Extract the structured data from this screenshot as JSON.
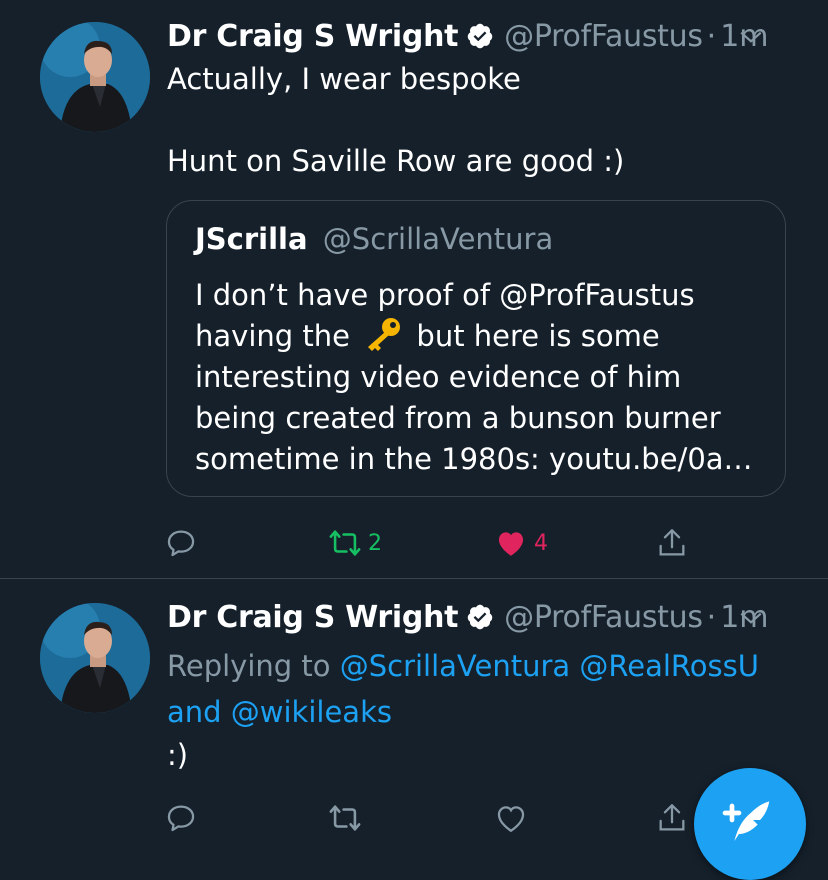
{
  "colors": {
    "background": "#15202b",
    "text": "#ffffff",
    "secondary": "#8899a6",
    "link": "#1da1f2",
    "retweet_green": "#17bf63",
    "like_red": "#e0245e",
    "border": "#38444d"
  },
  "tweets": [
    {
      "author_name": "Dr Craig S Wright",
      "handle": "@ProfFaustus",
      "separator": "·",
      "time": "1m",
      "text": "Actually, I wear bespoke\n\nHunt on Saville Row are good :)",
      "quote": {
        "author_name": "JScrilla",
        "handle": "@ScrillaVentura",
        "text_before_emoji": "I don’t have proof of @ProfFaustus having the",
        "emoji": "key-emoji",
        "text_after_emoji": "but here is some interesting video evidence of him being created from a bunson burner sometime in the 1980s: youtu.be/0a…"
      },
      "actions": {
        "reply_count": "",
        "retweet_count": "2",
        "like_count": "4",
        "retweeted": true,
        "liked": true
      }
    },
    {
      "author_name": "Dr Craig S Wright",
      "handle": "@ProfFaustus",
      "separator": "·",
      "time": "1m",
      "replying_label": "Replying to",
      "replying_mentions": "@ScrillaVentura @RealRossU",
      "replying_and": "and",
      "replying_last": "@wikileaks",
      "text": ":)",
      "actions": {
        "reply_count": "",
        "retweet_count": "",
        "like_count": "",
        "retweeted": false,
        "liked": false
      }
    }
  ],
  "compose_button": {
    "icon": "compose-tweet-icon"
  }
}
